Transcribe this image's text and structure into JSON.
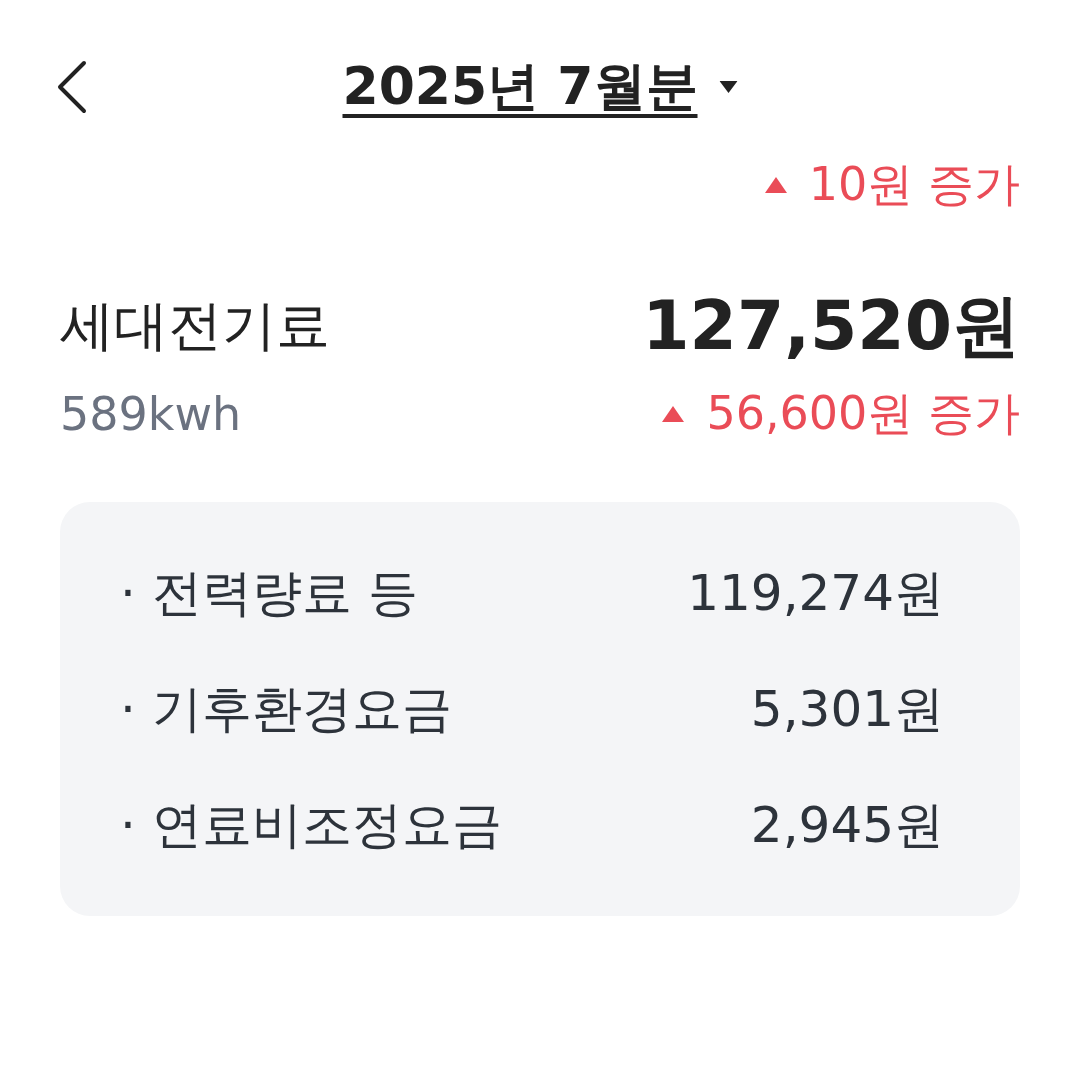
{
  "header": {
    "title": "2025년 7월분"
  },
  "top_change": {
    "increase": true,
    "text": "10원 증가"
  },
  "summary": {
    "label": "세대전기료",
    "amount": "127,520원",
    "usage": "589kwh",
    "change": {
      "increase": true,
      "text": "56,600원 증가"
    }
  },
  "breakdown": [
    {
      "bullet": "·",
      "label": "전력량료 등",
      "amount": "119,274원"
    },
    {
      "bullet": "·",
      "label": "기후환경요금",
      "amount": "5,301원"
    },
    {
      "bullet": "·",
      "label": "연료비조정요금",
      "amount": "2,945원"
    }
  ]
}
